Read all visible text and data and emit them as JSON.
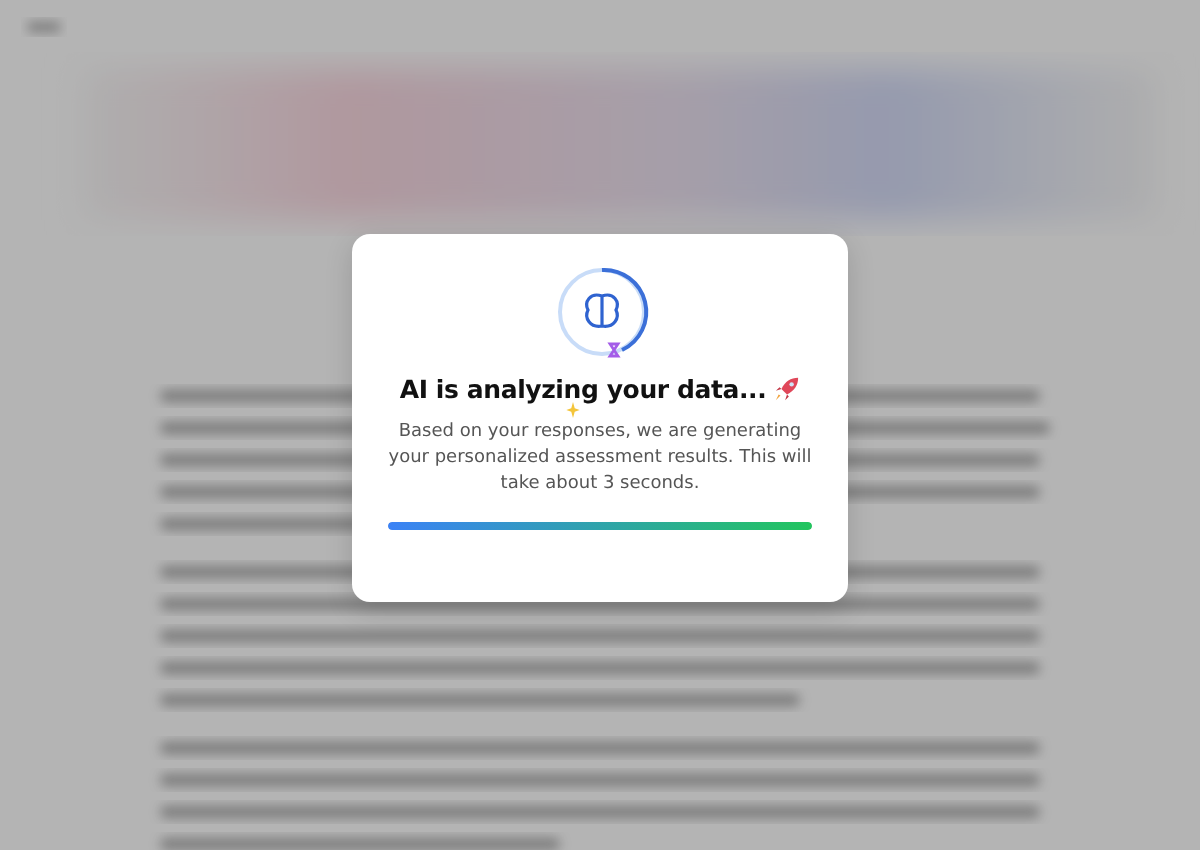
{
  "modal": {
    "title": "AI is analyzing your data...",
    "message": "Based on your responses, we are generating your personalized assessment results. This will take about 3 seconds.",
    "progress": {
      "level": 1
    }
  }
}
